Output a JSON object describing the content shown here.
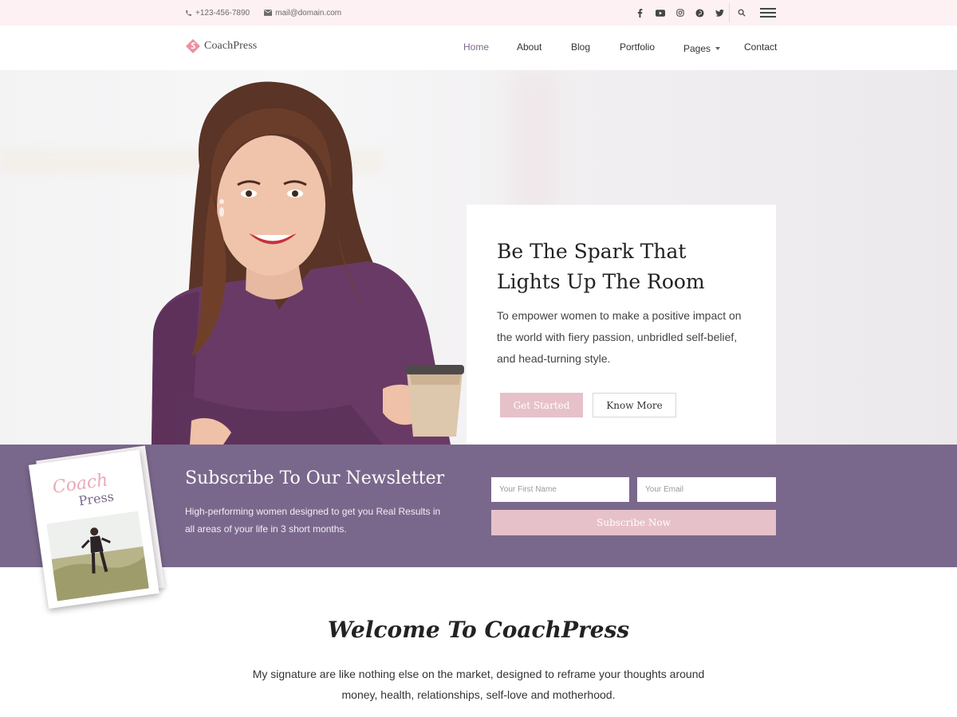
{
  "topbar": {
    "phone": "+123-456-7890",
    "email": "mail@domain.com",
    "social_icons": [
      "facebook-icon",
      "youtube-icon",
      "instagram-icon",
      "pinterest-icon",
      "twitter-icon"
    ]
  },
  "header": {
    "logo_text": "CoachPress",
    "nav": [
      {
        "label": "Home",
        "active": true
      },
      {
        "label": "About",
        "active": false
      },
      {
        "label": "Blog",
        "active": false
      },
      {
        "label": "Portfolio",
        "active": false
      },
      {
        "label": "Pages",
        "active": false,
        "has_dropdown": true
      },
      {
        "label": "Contact",
        "active": false
      }
    ]
  },
  "hero": {
    "title": "Be The Spark That Lights Up The Room",
    "description": "To empower women to make a positive impact on the world with fiery passion, unbridled self-belief, and head-turning style.",
    "primary_button": "Get Started",
    "secondary_button": "Know More"
  },
  "newsletter": {
    "title": "Subscribe To Our Newsletter",
    "description": "High-performing women designed to get you Real Results in all areas of your life in 3 short months.",
    "first_name_placeholder": "Your First Name",
    "email_placeholder": "Your Email",
    "submit_label": "Subscribe Now",
    "book": {
      "word1": "Coach",
      "word2": "Press"
    }
  },
  "welcome": {
    "title": "Welcome To CoachPress",
    "text": "My signature are like nothing else on the market, designed to reframe your thoughts around money, health, relationships, self-love and motherhood."
  },
  "colors": {
    "topbar_bg": "#fdf1f4",
    "accent_pink": "#e6c1c9",
    "newsletter_purple": "#7a688c",
    "nav_active": "#7d6a8d"
  }
}
